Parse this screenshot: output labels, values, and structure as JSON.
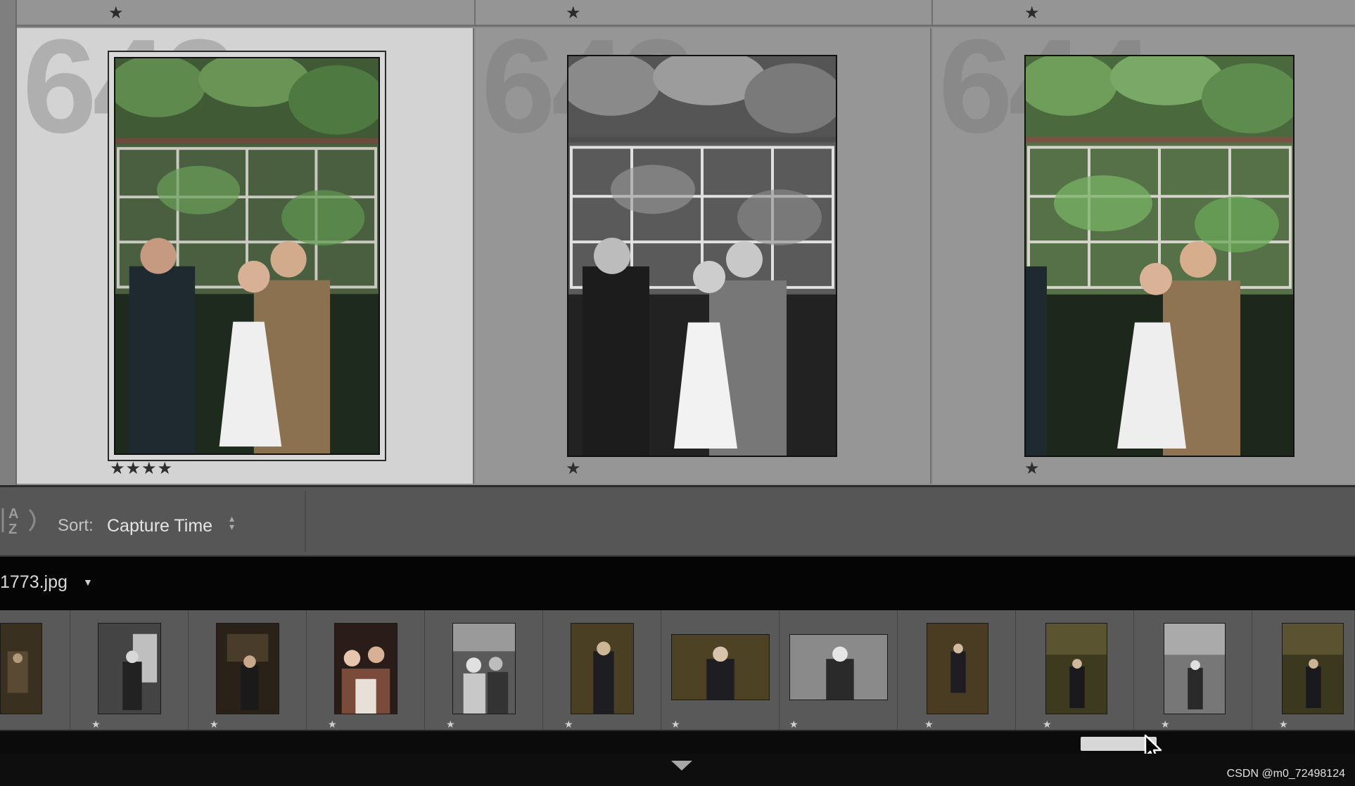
{
  "grid": {
    "column_headers": [
      {
        "rating": "★"
      },
      {
        "rating": "★"
      },
      {
        "rating": "★"
      }
    ],
    "cells": [
      {
        "index_number": "642",
        "rating": "★★★★",
        "selected": true,
        "tone": "color"
      },
      {
        "index_number": "643",
        "rating": "★",
        "selected": false,
        "tone": "bw"
      },
      {
        "index_number": "644",
        "rating": "★",
        "selected": false,
        "tone": "color"
      }
    ]
  },
  "toolbar": {
    "sort_icon": "az-sort-icon",
    "sort_label": "Sort:",
    "sort_value": "Capture Time",
    "sort_arrows_icon": "up-down-arrows-icon"
  },
  "filmstrip": {
    "filename": "1773.jpg",
    "filename_dropdown_icon": "caret-down-icon",
    "thumbnails": [
      {
        "tone": "warm",
        "orientation": "portrait",
        "rating": ""
      },
      {
        "tone": "bw",
        "orientation": "portrait",
        "rating": "★"
      },
      {
        "tone": "warm",
        "orientation": "portrait",
        "rating": "★"
      },
      {
        "tone": "color",
        "orientation": "portrait",
        "rating": "★"
      },
      {
        "tone": "bw",
        "orientation": "portrait",
        "rating": "★"
      },
      {
        "tone": "warm",
        "orientation": "portrait",
        "rating": "★"
      },
      {
        "tone": "warm",
        "orientation": "landscape",
        "rating": "★"
      },
      {
        "tone": "bw",
        "orientation": "landscape",
        "rating": "★"
      },
      {
        "tone": "warm",
        "orientation": "portrait",
        "rating": "★"
      },
      {
        "tone": "warm",
        "orientation": "portrait",
        "rating": "★"
      },
      {
        "tone": "bw",
        "orientation": "portrait",
        "rating": "★"
      },
      {
        "tone": "warm",
        "orientation": "portrait",
        "rating": "★"
      }
    ]
  },
  "bottom": {
    "collapse_icon": "triangle-down-icon",
    "watermark": "CSDN @m0_72498124"
  },
  "colors": {
    "selected_cell": "#d3d3d3",
    "cell": "#969696",
    "toolbar": "#565656",
    "filmstrip": "#595959"
  }
}
